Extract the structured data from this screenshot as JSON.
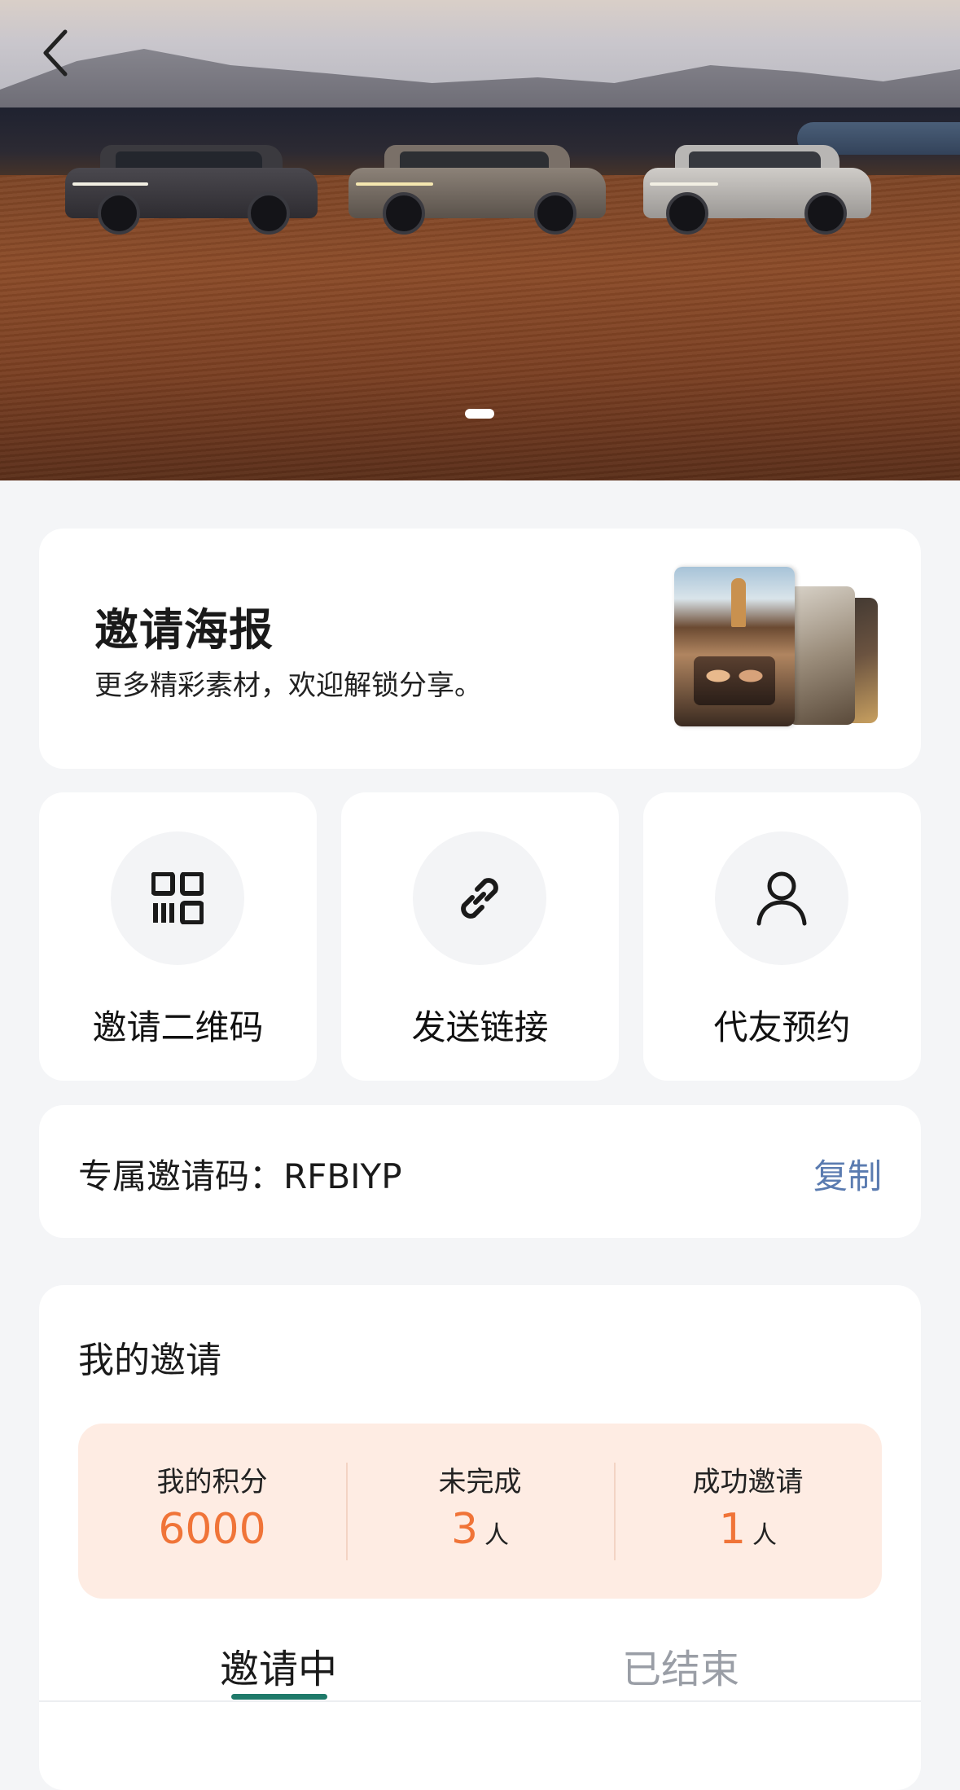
{
  "hero": {
    "slide_count": 1,
    "active_slide": 1
  },
  "poster": {
    "title": "邀请海报",
    "subtitle": "更多精彩素材，欢迎解锁分享。"
  },
  "actions": [
    {
      "label": "邀请二维码",
      "icon": "qr-code-icon"
    },
    {
      "label": "发送链接",
      "icon": "link-icon"
    },
    {
      "label": "代友预约",
      "icon": "user-icon"
    }
  ],
  "invite_code": {
    "label": "专属邀请码：RFBIYP",
    "copy_label": "复制"
  },
  "my_invite": {
    "title": "我的邀请",
    "stats": [
      {
        "label": "我的积分",
        "value": "6000",
        "unit": ""
      },
      {
        "label": "未完成",
        "value": "3",
        "unit": "人"
      },
      {
        "label": "成功邀请",
        "value": "1",
        "unit": "人"
      }
    ],
    "tabs": [
      {
        "label": "邀请中",
        "active": true
      },
      {
        "label": "已结束",
        "active": false
      }
    ]
  },
  "colors": {
    "accent_orange": "#f07438",
    "link_blue": "#5a7bb0",
    "tab_underline": "#1f7a6a",
    "stats_bg": "#feece3"
  }
}
